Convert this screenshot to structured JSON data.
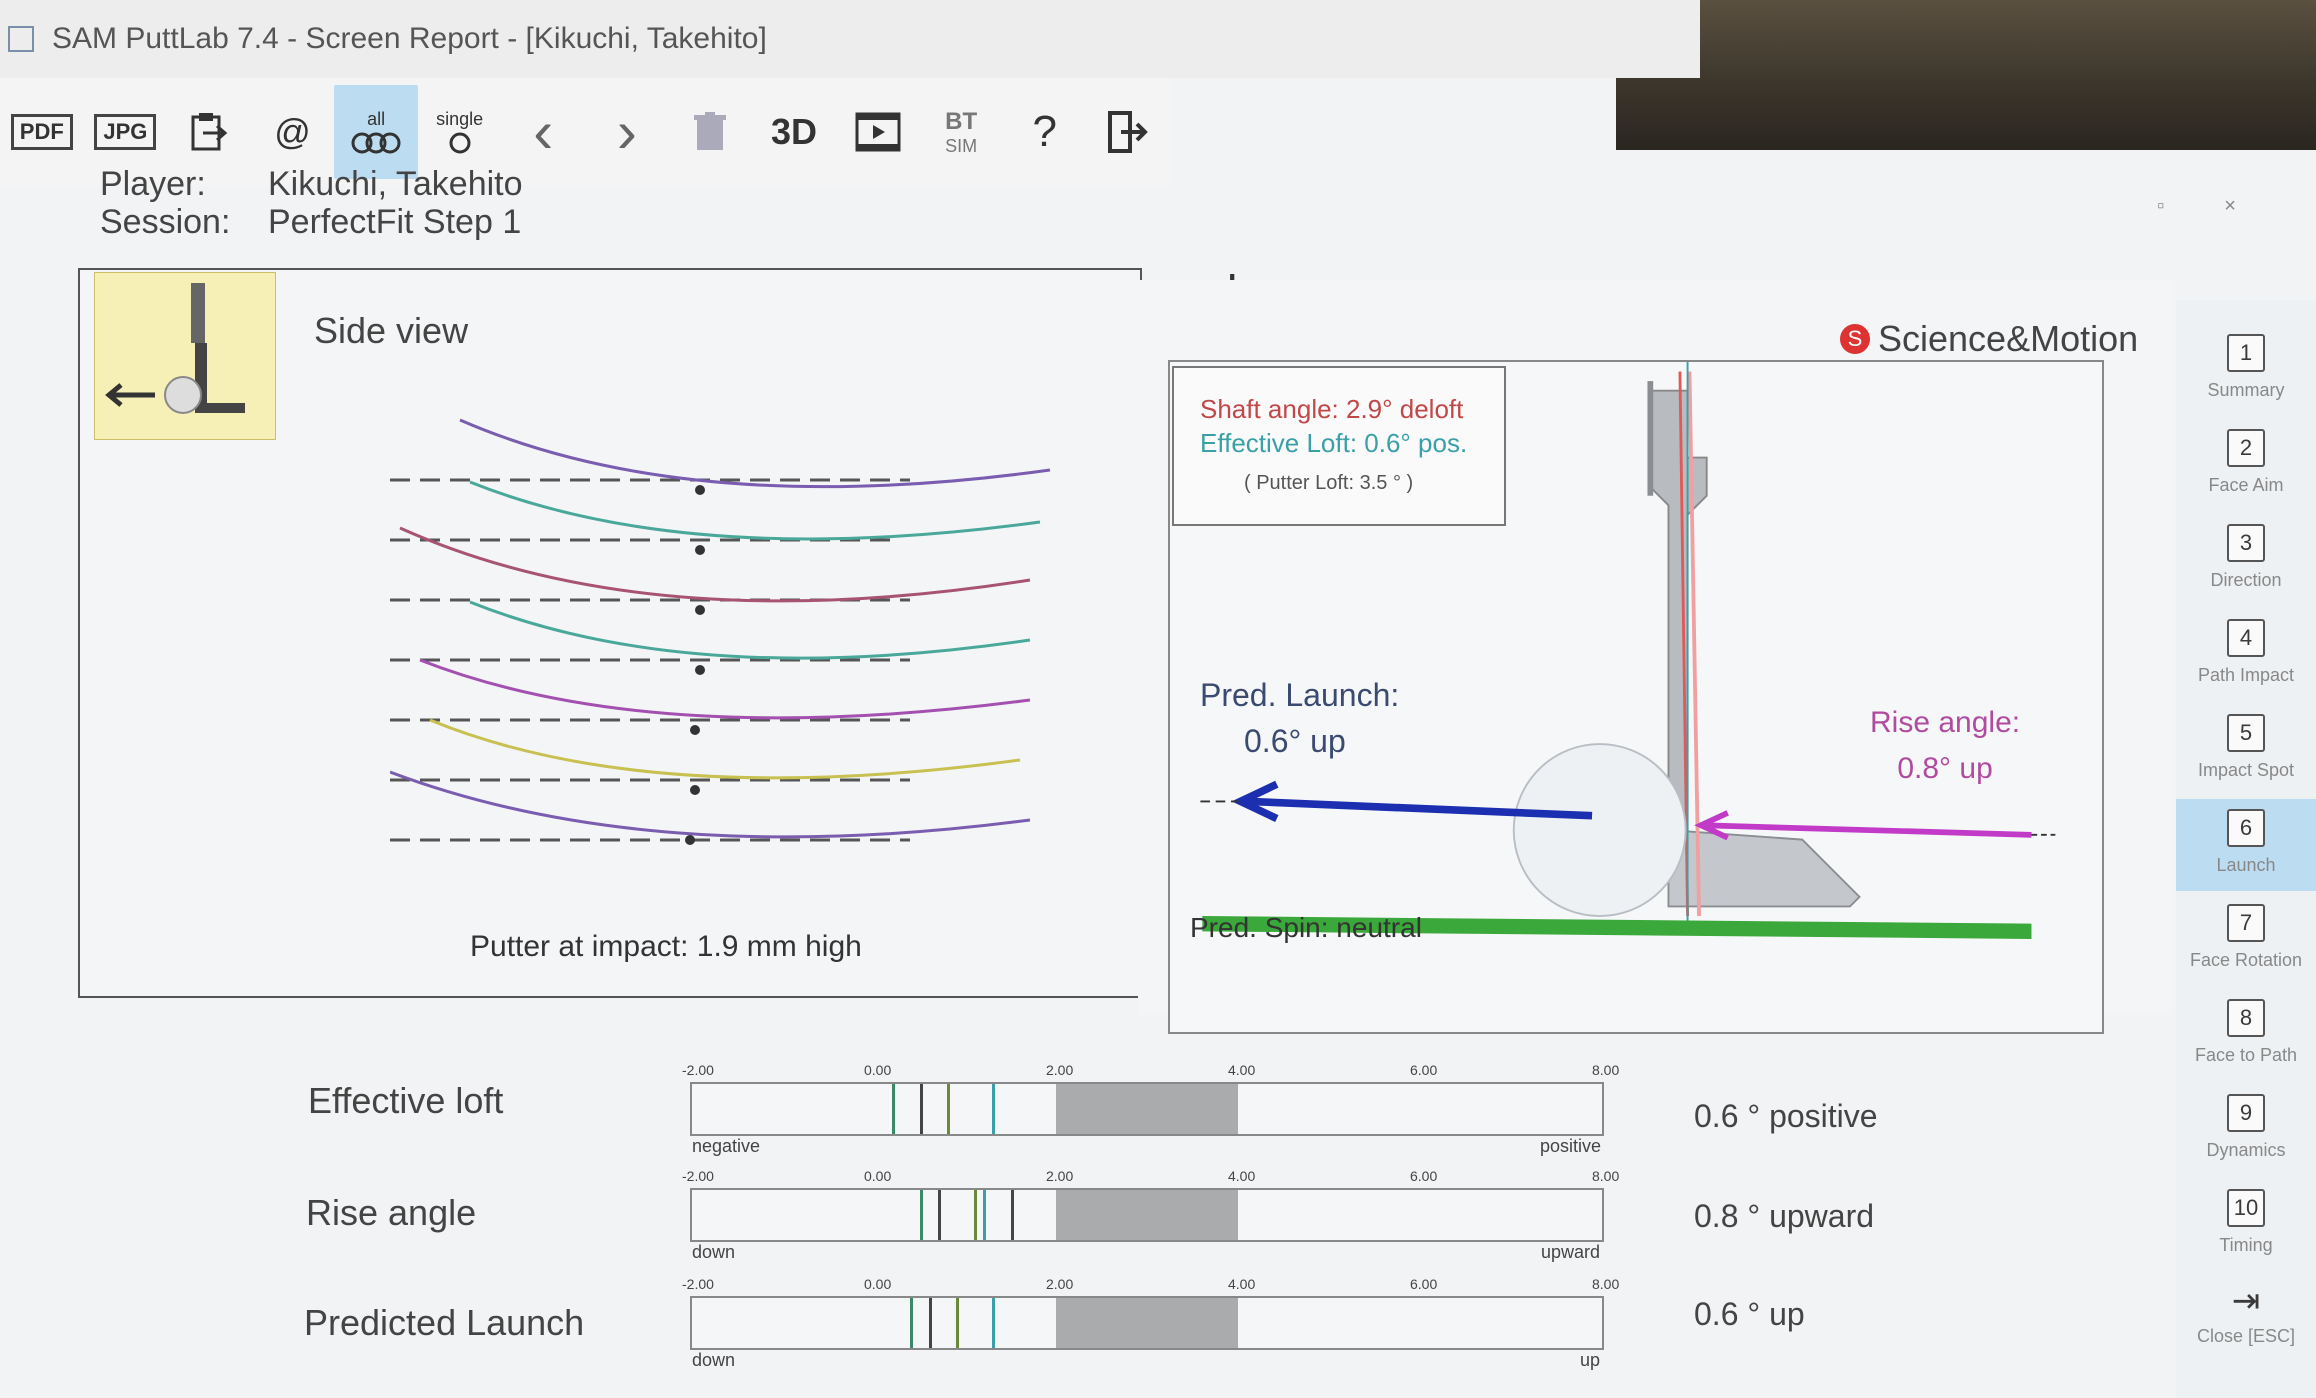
{
  "window": {
    "title": "SAM PuttLab 7.4 - Screen Report - [Kikuchi, Takehito]"
  },
  "toolbar": {
    "pdf": "PDF",
    "jpg": "JPG",
    "export_icon": "export-icon",
    "email": "@",
    "all_label": "all",
    "single_label": "single",
    "prev": "‹",
    "next": "›",
    "delete_icon": "trash-icon",
    "three_d": "3D",
    "play_icon": "play-icon",
    "bt_label": "BT",
    "sim_label": "SIM",
    "help": "?",
    "exit_icon": "exit-icon"
  },
  "player": {
    "label": "Player:",
    "value": "Kikuchi, Takehito"
  },
  "session": {
    "label": "Session:",
    "value": "PerfectFit Step 1"
  },
  "page_title": "Launch",
  "side_view": {
    "label": "Side view",
    "impact_text": "Putter at impact:  1.9 mm high"
  },
  "brand": {
    "name": "Science&Motion"
  },
  "angles": {
    "shaft": "Shaft angle: 2.9° deloft",
    "effective_loft": "Effective Loft: 0.6° pos.",
    "putter_loft": "( Putter Loft: 3.5 ° )"
  },
  "pred_launch": {
    "label": "Pred. Launch:",
    "value": "0.6° up"
  },
  "rise_angle": {
    "label": "Rise angle:",
    "value": "0.8° up"
  },
  "pred_spin": "Pred. Spin: neutral",
  "colors": {
    "green": "#3aa83a",
    "blue": "#1c2fb0",
    "magenta": "#c23ac8",
    "shaft_red": "#e05a5a",
    "band": "#a9abad",
    "active_nav": "#bcdcf2"
  },
  "nav": [
    {
      "num": "1",
      "label": "Summary"
    },
    {
      "num": "2",
      "label": "Face Aim"
    },
    {
      "num": "3",
      "label": "Direction"
    },
    {
      "num": "4",
      "label": "Path Impact"
    },
    {
      "num": "5",
      "label": "Impact Spot"
    },
    {
      "num": "6",
      "label": "Launch"
    },
    {
      "num": "7",
      "label": "Face Rotation"
    },
    {
      "num": "8",
      "label": "Face to Path"
    },
    {
      "num": "9",
      "label": "Dynamics"
    },
    {
      "num": "10",
      "label": "Timing"
    },
    {
      "num": "",
      "label": "Close [ESC]"
    }
  ],
  "active_nav": 5,
  "metrics": {
    "scale_labels": [
      "-2.00",
      "0.00",
      "2.00",
      "4.00",
      "6.00",
      "8.00"
    ],
    "effective_loft": {
      "label": "Effective loft",
      "value": "0.6 ° positive",
      "left_end": "negative",
      "right_end": "positive",
      "band": [
        2.0,
        4.0
      ],
      "marks": [
        0.2,
        0.5,
        0.8,
        1.3
      ]
    },
    "rise_angle": {
      "label": "Rise angle",
      "value": "0.8 ° upward",
      "left_end": "down",
      "right_end": "upward",
      "band": [
        2.0,
        4.0
      ],
      "marks": [
        0.5,
        0.7,
        1.1,
        1.2,
        1.5
      ]
    },
    "predicted_launch": {
      "label": "Predicted Launch",
      "value": "0.6 ° up",
      "left_end": "down",
      "right_end": "up",
      "band": [
        2.0,
        4.0
      ],
      "marks": [
        0.4,
        0.6,
        0.9,
        1.3
      ]
    }
  }
}
